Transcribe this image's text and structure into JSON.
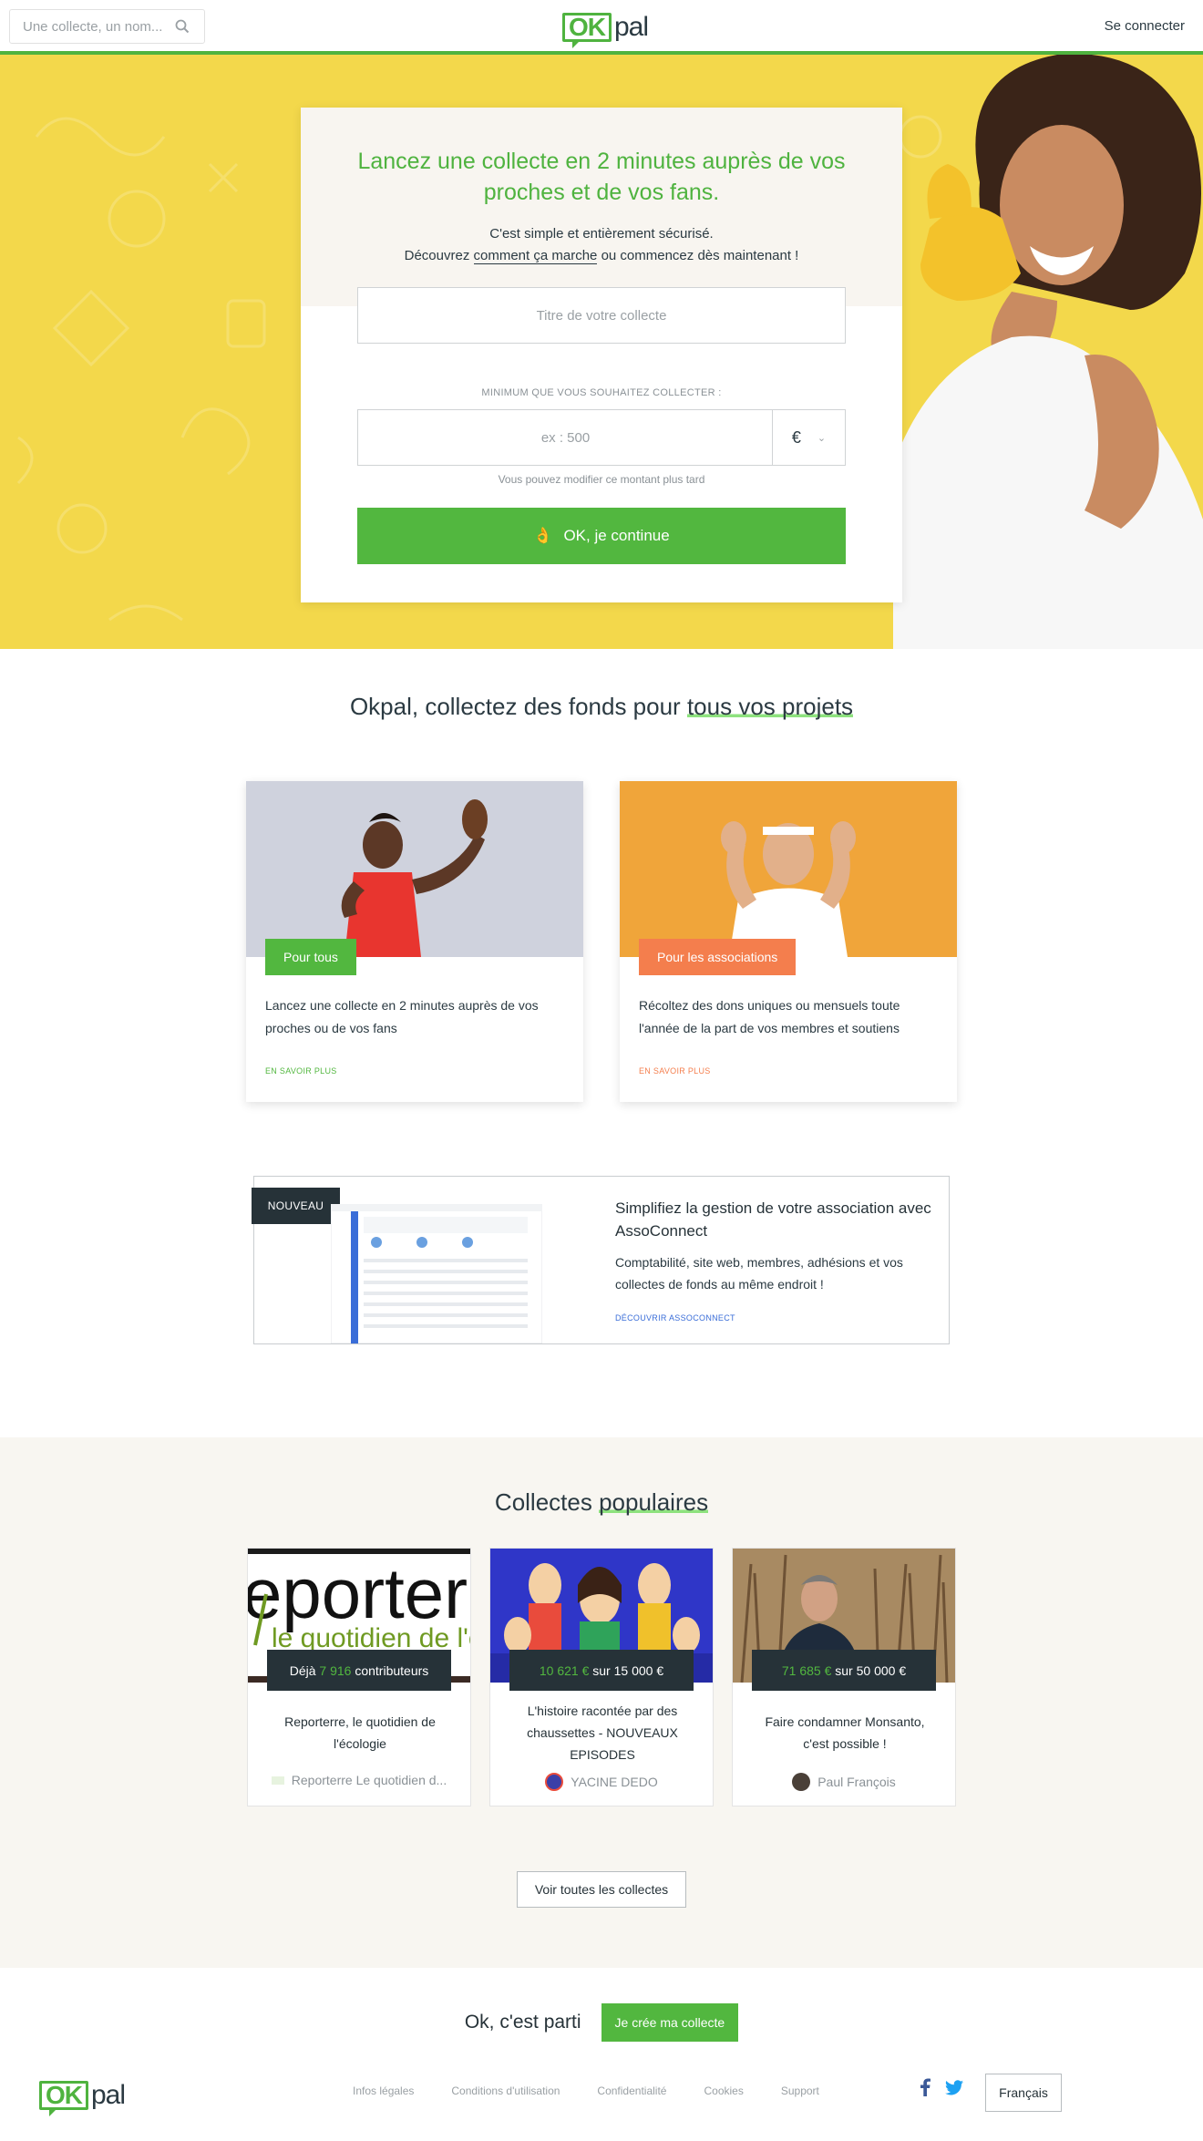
{
  "header": {
    "search_placeholder": "Une collecte, un nom...",
    "logo_ok": "OK",
    "logo_pal": "pal",
    "login": "Se connecter"
  },
  "hero": {
    "title": "Lancez une collecte en 2 minutes auprès de vos proches et de vos fans.",
    "subtitle_line1": "C'est simple et entièrement sécurisé.",
    "subtitle_prefix": "Découvrez",
    "subtitle_link": "comment ça marche",
    "subtitle_suffix": "ou commencez dès maintenant !",
    "title_placeholder": "Titre de votre collecte",
    "min_label": "MINIMUM QUE VOUS SOUHAITEZ COLLECTER :",
    "amount_placeholder": "ex : 500",
    "currency": "€",
    "hint": "Vous pouvez modifier ce montant plus tard",
    "cta_emoji": "👌",
    "cta_label": "OK, je continue"
  },
  "projects": {
    "title_prefix": "Okpal, collectez des fonds pour",
    "title_highlight": "tous vos projets",
    "cards": [
      {
        "tag": "Pour tous",
        "description": "Lancez une collecte en 2 minutes auprès de vos proches ou de vos fans",
        "more": "EN SAVOIR PLUS"
      },
      {
        "tag": "Pour les associations",
        "description": "Récoltez des dons uniques ou mensuels toute l'année de la part de vos membres et soutiens",
        "more": "EN SAVOIR PLUS"
      }
    ]
  },
  "asso": {
    "badge": "NOUVEAU",
    "title": "Simplifiez la gestion de votre association avec AssoConnect",
    "description": "Comptabilité, site web, membres, adhésions et vos collectes de fonds au même endroit !",
    "link": "DÉCOUVRIR ASSOCONNECT"
  },
  "popular": {
    "title_prefix": "Collectes",
    "title_highlight": "populaires",
    "cards": [
      {
        "stat_prefix": "Déjà",
        "stat_value": "7 916",
        "stat_suffix": "contributeurs",
        "name": "Reporterre, le quotidien de l'écologie",
        "author": "Reporterre Le quotidien d..."
      },
      {
        "stat_value": "10 621 €",
        "stat_suffix": "sur 15 000 €",
        "name": "L'histoire racontée par des chaussettes - NOUVEAUX EPISODES",
        "author": "YACINE DEDO"
      },
      {
        "stat_value": "71 685 €",
        "stat_suffix": "sur 50 000 €",
        "name": "Faire condamner Monsanto, c'est possible !",
        "author": "Paul François"
      }
    ],
    "see_all": "Voir toutes les collectes"
  },
  "footer": {
    "cta_text": "Ok, c'est parti",
    "cta_button": "Je crée ma collecte",
    "links": [
      "Infos légales",
      "Conditions d'utilisation",
      "Confidentialité",
      "Cookies",
      "Support"
    ],
    "language": "Français"
  },
  "colors": {
    "brand_green": "#52b73f",
    "hero_yellow": "#f3d84b",
    "association_orange": "#f47e4d",
    "dark": "#263238",
    "asso_link_blue": "#3a6dd8"
  }
}
